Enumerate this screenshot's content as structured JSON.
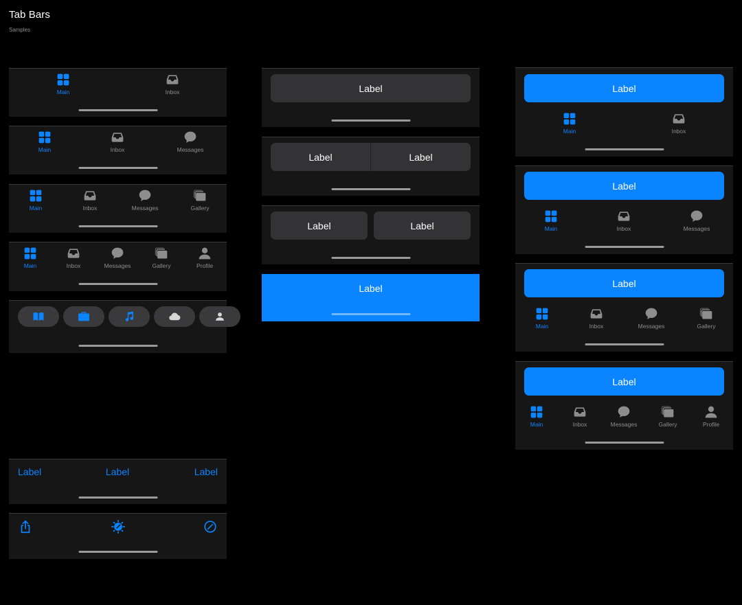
{
  "header": {
    "title": "Tab Bars",
    "subtitle": "Samples"
  },
  "tabs": {
    "main": "Main",
    "inbox": "Inbox",
    "messages": "Messages",
    "gallery": "Gallery",
    "profile": "Profile"
  },
  "button_label": "Label",
  "text_tabs": [
    "Label",
    "Label",
    "Label"
  ],
  "pills": [
    "book-icon",
    "briefcase-icon",
    "music-note-icon",
    "cloud-icon",
    "person-icon"
  ],
  "toolbar_icons": [
    "share-icon",
    "brightness-dial-icon",
    "compass-icon"
  ],
  "colors": {
    "accent": "#0a84ff",
    "inactive": "#8d8d8d",
    "bar": "#161616",
    "button": "#333336"
  }
}
